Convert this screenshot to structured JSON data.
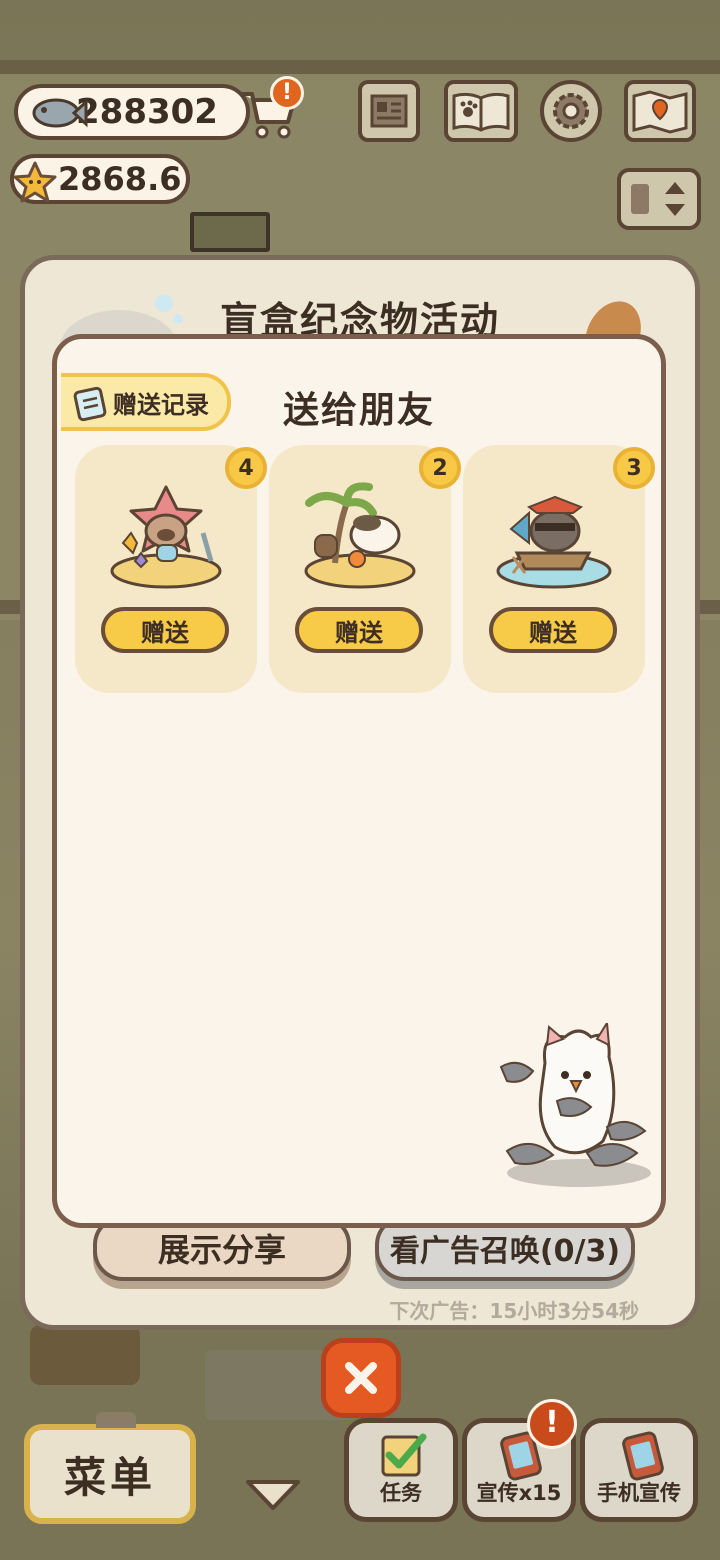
{
  "hud": {
    "fish_count": "288302",
    "star_count": "2868.6",
    "cart_alert": "!"
  },
  "event": {
    "title": "盲盒纪念物活动",
    "share_label": "展示分享",
    "ad_label": "看广告召唤(0/3)",
    "next_ad": "下次广告：15小时3分54秒"
  },
  "gift": {
    "title": "送给朋友",
    "history_label": "赠送记录",
    "cards": [
      {
        "count": "4",
        "button": "赠送",
        "art": "starfish-hat-cat-island"
      },
      {
        "count": "2",
        "button": "赠送",
        "art": "palm-tree-cat-island"
      },
      {
        "count": "3",
        "button": "赠送",
        "art": "pirate-raccoon-boat"
      }
    ]
  },
  "bottom": {
    "menu_label": "菜单",
    "tasks_label": "任务",
    "promo_label": "宣传x15",
    "promo_alert": "!",
    "phone_promo_label": "手机宣传"
  },
  "colors": {
    "accent_yellow": "#f7ca47",
    "close_orange": "#e45a22",
    "panel_border": "#7c5e4c"
  }
}
